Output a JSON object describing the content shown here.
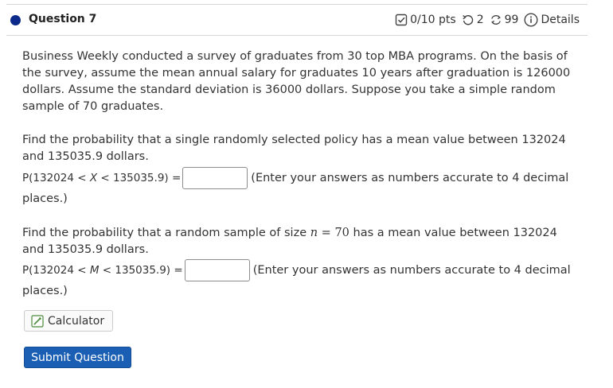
{
  "question": {
    "title": "Question 7",
    "score": "0/10 pts",
    "retries": "2",
    "attempts": "99",
    "details_label": "Details"
  },
  "problem": {
    "intro": "Business Weekly conducted a survey of graduates from 30 top MBA programs. On the basis of the survey, assume the mean annual salary for graduates 10 years after graduation is 126000 dollars. Assume the standard deviation is 36000 dollars. Suppose you take a simple random sample of 70 graduates.",
    "part1": {
      "prompt": "Find the probability that a single randomly selected policy has a mean value between 132024 and 135035.9 dollars.",
      "eq_prefix": "P(132024 < ",
      "eq_var": "X",
      "eq_suffix": " < 135035.9) =",
      "answer_value": "",
      "hint": "(Enter your answers as numbers accurate to 4 decimal",
      "hint_cont": "places.)"
    },
    "part2": {
      "prompt_before": "Find the probability that a random sample of size ",
      "math_n": "n",
      "math_eq": " = 70",
      "prompt_after": " has a mean value between 132024 and 135035.9 dollars.",
      "eq_prefix": "P(132024 < ",
      "eq_var": "M",
      "eq_suffix": " < 135035.9) =",
      "answer_value": "",
      "hint": "(Enter your answers as numbers accurate to 4 decimal",
      "hint_cont": "places.)"
    }
  },
  "buttons": {
    "calculator": "Calculator",
    "submit": "Submit Question"
  },
  "colors": {
    "accent": "#1a5fb4",
    "question_dot": "#0b2a8a"
  }
}
